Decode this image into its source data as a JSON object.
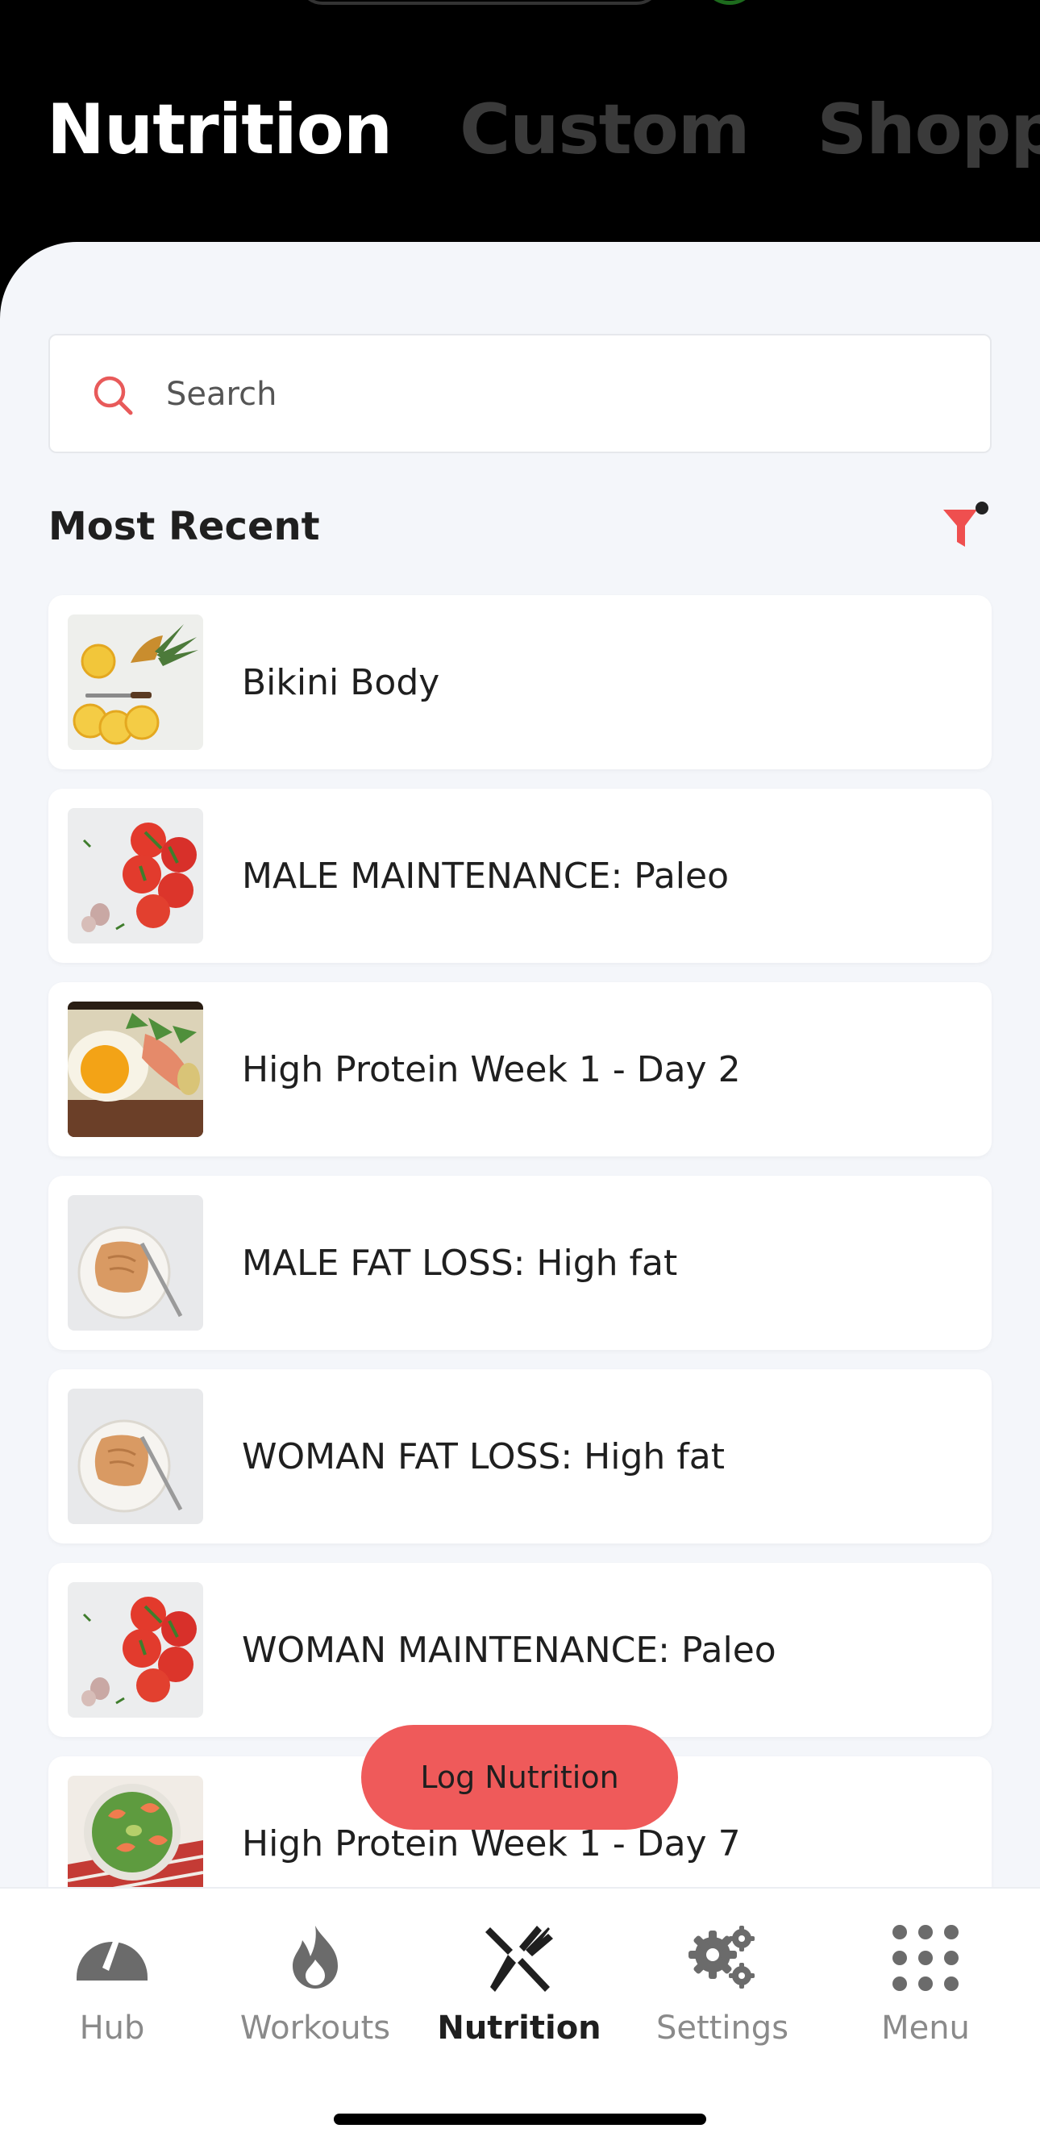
{
  "colors": {
    "accent": "#ef5a5a",
    "background": "#f4f6fa",
    "header": "#000000"
  },
  "header": {
    "tabs": [
      {
        "label": "Nutrition",
        "active": true
      },
      {
        "label": "Custom",
        "active": false
      },
      {
        "label": "Shoppin",
        "active": false
      }
    ]
  },
  "search": {
    "placeholder": "Search",
    "icon": "search-icon"
  },
  "section": {
    "title": "Most Recent",
    "filter_icon": "filter-icon"
  },
  "plans": [
    {
      "label": "Bikini Body",
      "thumb": "pineapple"
    },
    {
      "label": "MALE MAINTENANCE: Paleo",
      "thumb": "tomatoes"
    },
    {
      "label": "High Protein Week 1 - Day 2",
      "thumb": "egg-toast"
    },
    {
      "label": "MALE FAT LOSS: High fat",
      "thumb": "nut-butter-toast"
    },
    {
      "label": "WOMAN FAT LOSS: High fat",
      "thumb": "nut-butter-toast"
    },
    {
      "label": "WOMAN MAINTENANCE: Paleo",
      "thumb": "tomatoes"
    },
    {
      "label": "High Protein Week 1 - Day 7",
      "thumb": "shrimp-salad"
    }
  ],
  "log_button": {
    "label": "Log Nutrition"
  },
  "tabbar": {
    "items": [
      {
        "label": "Hub",
        "icon": "gauge-icon",
        "active": false
      },
      {
        "label": "Workouts",
        "icon": "flame-icon",
        "active": false
      },
      {
        "label": "Nutrition",
        "icon": "fork-knife-icon",
        "active": true
      },
      {
        "label": "Settings",
        "icon": "gears-icon",
        "active": false
      },
      {
        "label": "Menu",
        "icon": "grid-dots-icon",
        "active": false
      }
    ]
  }
}
